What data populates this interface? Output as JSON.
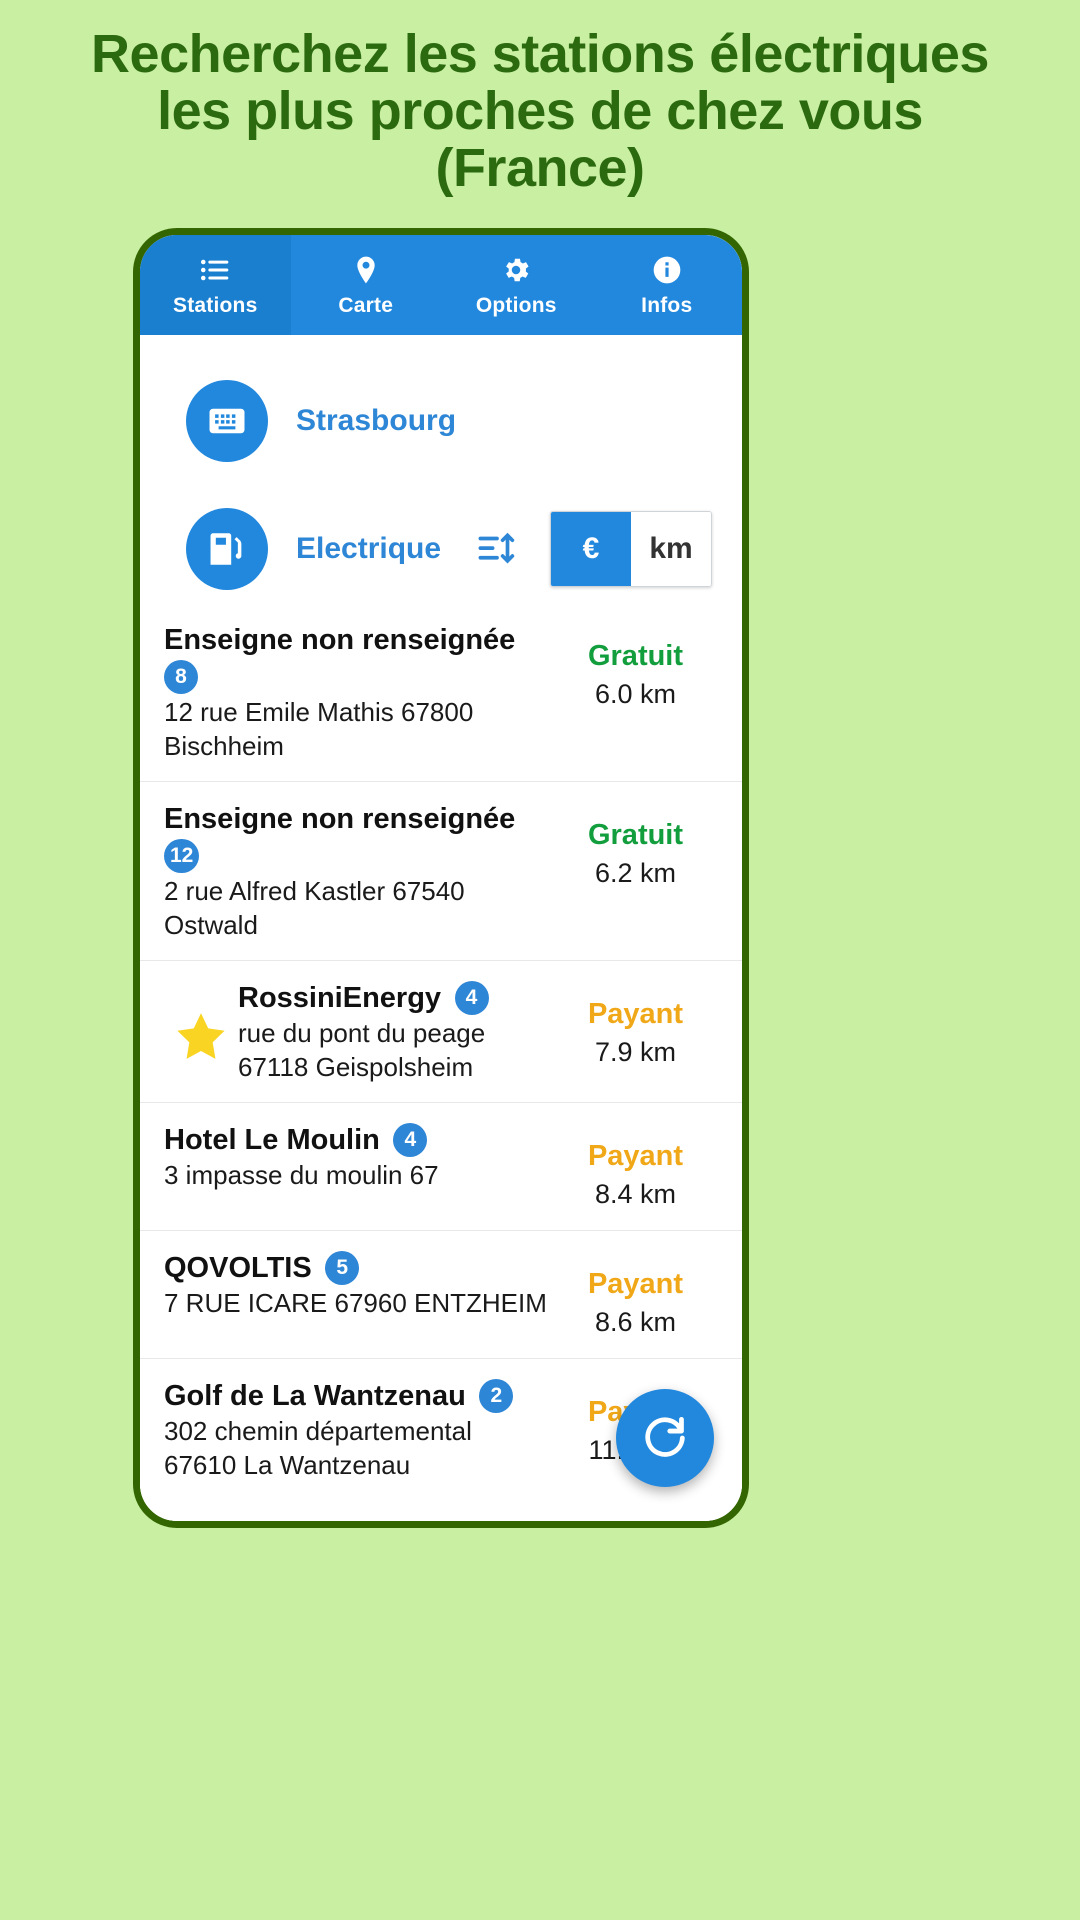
{
  "promo": {
    "line1": "Recherchez les stations électriques",
    "line2": "les plus proches de chez vous",
    "line3": "(France)",
    "color": "#2c6a10",
    "background": "#c9f0a2"
  },
  "app": {
    "accent": "#2288dd",
    "active_tab_color": "#1b7fd0",
    "tabs": [
      {
        "label": "Stations",
        "icon": "list-icon",
        "active": true
      },
      {
        "label": "Carte",
        "icon": "map-pin-icon",
        "active": false
      },
      {
        "label": "Options",
        "icon": "gear-icon",
        "active": false
      },
      {
        "label": "Infos",
        "icon": "info-icon",
        "active": false
      }
    ],
    "city_row": {
      "icon": "keyboard-icon",
      "value": "Strasbourg"
    },
    "filter_row": {
      "icon": "fuel-pump-icon",
      "value": "Electrique",
      "sort_icon": "sort-icon",
      "toggle": [
        {
          "label": "€",
          "selected": true
        },
        {
          "label": "km",
          "selected": false
        }
      ]
    },
    "stations": [
      {
        "name": "Enseigne non renseignée",
        "badge": "8",
        "badge_below": true,
        "favorite": false,
        "address_line1": "12 rue Emile Mathis 67800",
        "address_line2": "Bischheim",
        "price": "Gratuit",
        "price_type": "free",
        "distance": "6.0 km"
      },
      {
        "name": "Enseigne non renseignée",
        "badge": "12",
        "badge_below": true,
        "favorite": false,
        "address_line1": "2 rue Alfred Kastler 67540",
        "address_line2": "Ostwald",
        "price": "Gratuit",
        "price_type": "free",
        "distance": "6.2 km"
      },
      {
        "name": "RossiniEnergy",
        "badge": "4",
        "badge_below": false,
        "favorite": true,
        "address_line1": "rue du pont du peage",
        "address_line2": "67118 Geispolsheim",
        "price": "Payant",
        "price_type": "paid",
        "distance": "7.9 km"
      },
      {
        "name": "Hotel Le Moulin",
        "badge": "4",
        "badge_below": false,
        "favorite": false,
        "address_line1": "3 impasse du moulin 67",
        "address_line2": "",
        "price": "Payant",
        "price_type": "paid",
        "distance": "8.4 km"
      },
      {
        "name": "QOVOLTIS",
        "badge": "5",
        "badge_below": false,
        "favorite": false,
        "address_line1": "7 RUE ICARE 67960 ENTZHEIM",
        "address_line2": "",
        "price": "Payant",
        "price_type": "paid",
        "distance": "8.6 km"
      },
      {
        "name": "Golf de La Wantzenau",
        "badge": "2",
        "badge_below": false,
        "favorite": false,
        "address_line1": "302 chemin départemental",
        "address_line2": "67610 La Wantzenau",
        "price": "Payant",
        "price_type": "paid",
        "distance": "11.0 km"
      }
    ],
    "fab": {
      "icon": "refresh-icon"
    },
    "colors": {
      "free": "#139e3e",
      "paid": "#f0a818",
      "badge": "#2e86d6",
      "star": "#f9d423"
    }
  }
}
